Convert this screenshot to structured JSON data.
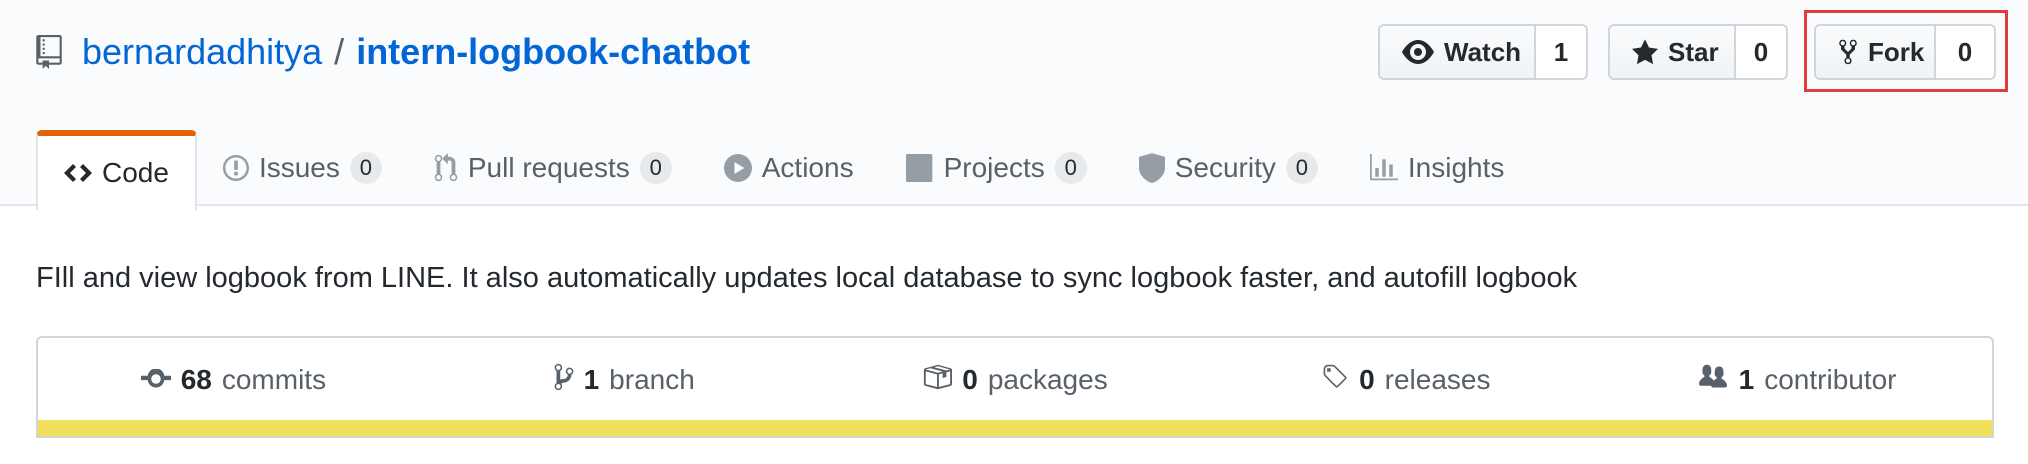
{
  "header": {
    "owner": "bernardadhitya",
    "separator": "/",
    "repo": "intern-logbook-chatbot",
    "icon": "repo-icon"
  },
  "actions": {
    "watch": {
      "label": "Watch",
      "count": "1",
      "icon": "eye-icon"
    },
    "star": {
      "label": "Star",
      "count": "0",
      "icon": "star-icon"
    },
    "fork": {
      "label": "Fork",
      "count": "0",
      "icon": "repo-forked-icon",
      "highlighted": true,
      "highlight_color": "#e03c3c"
    }
  },
  "tabs": [
    {
      "label": "Code",
      "icon": "code-icon",
      "selected": true
    },
    {
      "label": "Issues",
      "count": "0",
      "icon": "issue-opened-icon"
    },
    {
      "label": "Pull requests",
      "count": "0",
      "icon": "git-pull-request-icon"
    },
    {
      "label": "Actions",
      "icon": "play-icon"
    },
    {
      "label": "Projects",
      "count": "0",
      "icon": "project-icon"
    },
    {
      "label": "Security",
      "count": "0",
      "icon": "shield-icon"
    },
    {
      "label": "Insights",
      "icon": "graph-icon"
    }
  ],
  "description": "FIll and view logbook from LINE. It also automatically updates local database to sync logbook faster, and autofill logbook",
  "summary": {
    "commits": {
      "count": "68",
      "label": "commits",
      "icon": "history-icon"
    },
    "branches": {
      "count": "1",
      "label": "branch",
      "icon": "git-branch-icon"
    },
    "packages": {
      "count": "0",
      "label": "packages",
      "icon": "package-icon"
    },
    "releases": {
      "count": "0",
      "label": "releases",
      "icon": "tag-icon"
    },
    "contributors": {
      "count": "1",
      "label": "contributor",
      "icon": "people-icon"
    }
  },
  "colors": {
    "link": "#0366d6",
    "selected_tab_accent": "#e36209",
    "language_bar": "#f1e05a"
  }
}
